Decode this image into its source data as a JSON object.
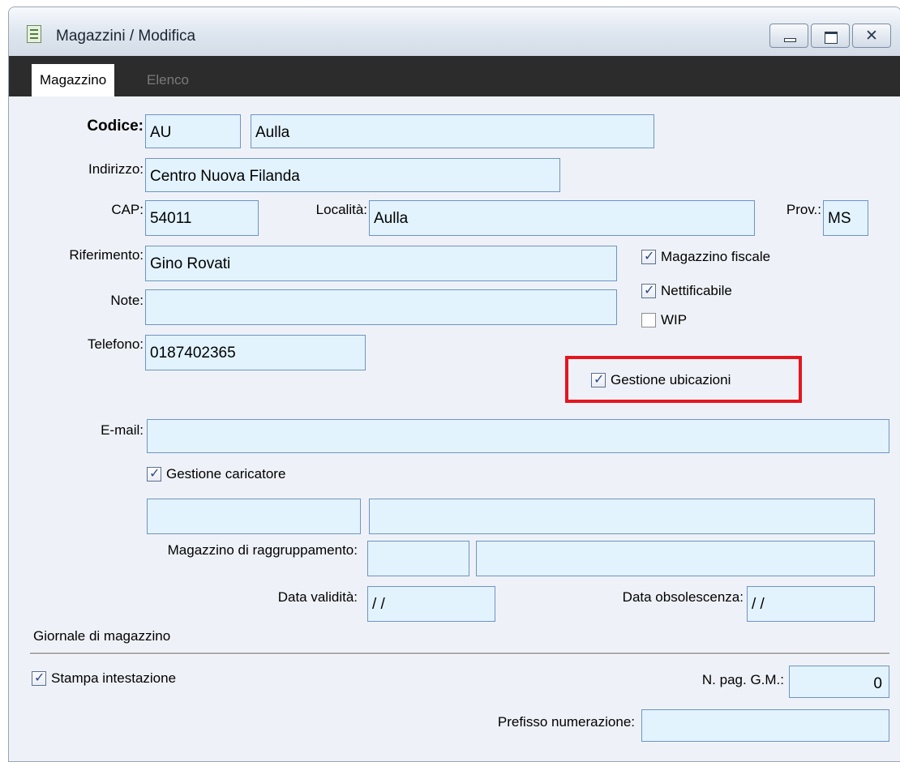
{
  "window": {
    "title": "Magazzini / Modifica"
  },
  "tabs": [
    {
      "label": "Magazzino"
    },
    {
      "label": "Elenco"
    }
  ],
  "labels": {
    "codice": "Codice:",
    "indirizzo": "Indirizzo:",
    "cap": "CAP:",
    "localita": "Località:",
    "prov": "Prov.:",
    "riferimento": "Riferimento:",
    "note": "Note:",
    "telefono": "Telefono:",
    "email": "E-mail:",
    "magazzino_raggruppamento": "Magazzino di raggruppamento:",
    "data_validita": "Data validità:",
    "data_obsolescenza": "Data obsolescenza:",
    "n_pag_gm": "N. pag. G.M.:",
    "prefisso_numerazione": "Prefisso numerazione:"
  },
  "fields": {
    "codice": "AU",
    "descrizione": "Aulla",
    "indirizzo": "Centro Nuova Filanda",
    "cap": "54011",
    "localita": "Aulla",
    "prov": "MS",
    "riferimento": "Gino Rovati",
    "note": "",
    "telefono": "0187402365",
    "email": "",
    "caricatore_codice": "",
    "caricatore_descrizione": "",
    "raggruppamento_codice": "",
    "raggruppamento_descrizione": "",
    "data_validita": " /  /",
    "data_obsolescenza": " /  /",
    "n_pag_gm": "0",
    "prefisso_numerazione": ""
  },
  "checkboxes": {
    "magazzino_fiscale": {
      "label": "Magazzino fiscale",
      "checked": true
    },
    "nettificabile": {
      "label": "Nettificabile",
      "checked": true
    },
    "wip": {
      "label": "WIP",
      "checked": false
    },
    "gestione_ubicazioni": {
      "label": "Gestione ubicazioni",
      "checked": true
    },
    "gestione_caricatore": {
      "label": "Gestione caricatore",
      "checked": true
    },
    "stampa_intestazione": {
      "label": "Stampa intestazione",
      "checked": true
    }
  },
  "sections": {
    "giornale": "Giornale di magazzino"
  },
  "colors": {
    "highlight": "#e5161e",
    "field_bg": "#e2f3fe",
    "field_border": "#6f93c4",
    "tabbar": "#2c2c2c"
  },
  "icons": {
    "app": "document-list-icon",
    "minimize": "minimize-icon",
    "maximize": "maximize-icon",
    "close": "close-icon"
  }
}
